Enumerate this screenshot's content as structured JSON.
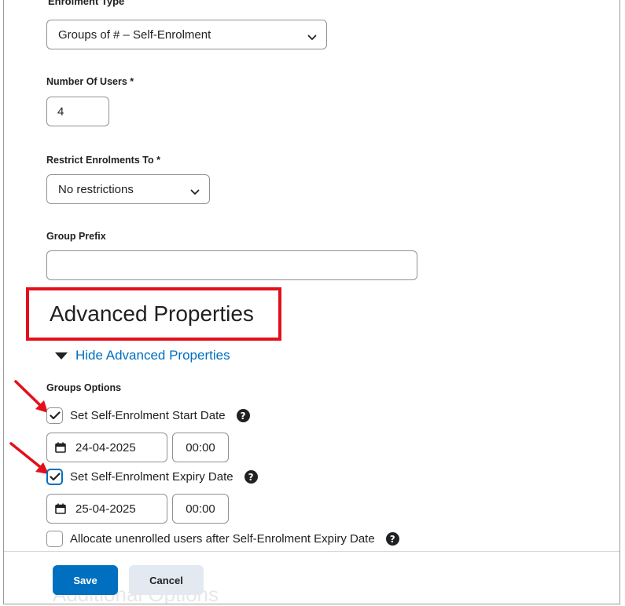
{
  "form": {
    "enrolment_type_label": "Enrolment Type",
    "enrolment_type_value": "Groups of # – Self-Enrolment",
    "number_of_users_label": "Number Of Users",
    "number_of_users_value": "4",
    "restrict_label": "Restrict Enrolments To",
    "restrict_value": "No restrictions",
    "group_prefix_label": "Group Prefix",
    "group_prefix_value": "",
    "required_marker": "*"
  },
  "advanced": {
    "title": "Advanced Properties",
    "toggle_label": "Hide Advanced Properties",
    "groups_options_label": "Groups Options",
    "start_checkbox_label": "Set Self-Enrolment Start Date",
    "start_date": "24-04-2025",
    "start_time": "00:00",
    "expiry_checkbox_label": "Set Self-Enrolment Expiry Date",
    "expiry_date": "25-04-2025",
    "expiry_time": "00:00",
    "allocate_label": "Allocate unenrolled users after Self-Enrolment Expiry Date",
    "start_checked": true,
    "expiry_checked": true,
    "allocate_checked": false,
    "help_glyph": "?"
  },
  "footer": {
    "save_label": "Save",
    "cancel_label": "Cancel",
    "ghost_text": "Additional Options"
  },
  "colors": {
    "accent": "#006fbf",
    "annotation_red": "#e3101c",
    "text": "#202122",
    "border": "#8f9294"
  },
  "icons": {
    "dropdown": "chevron-down-icon",
    "calendar": "calendar-icon",
    "help": "help-circle-icon",
    "check": "checkmark-icon",
    "toggle": "triangle-down-icon",
    "annotation": "red-arrow-icon"
  }
}
